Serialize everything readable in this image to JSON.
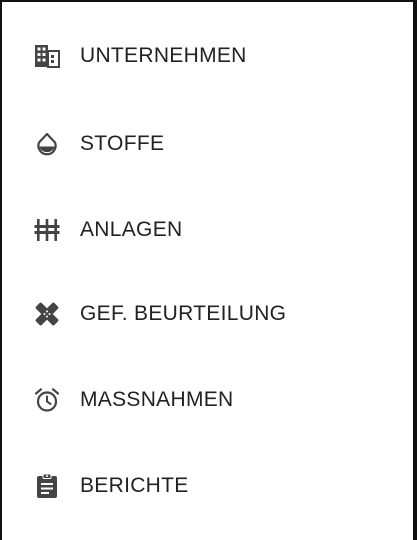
{
  "menu": {
    "items": [
      {
        "label": "UNTERNEHMEN",
        "icon": "domain-icon"
      },
      {
        "label": "STOFFE",
        "icon": "water-drop-icon"
      },
      {
        "label": "ANLAGEN",
        "icon": "equalizer-icon"
      },
      {
        "label": "GEF. BEURTEILUNG",
        "icon": "bandage-icon"
      },
      {
        "label": "MASSNAHMEN",
        "icon": "alarm-icon"
      },
      {
        "label": "BERICHTE",
        "icon": "clipboard-icon"
      }
    ]
  },
  "colors": {
    "icon": "#444444",
    "text": "#222222",
    "frame": "#111111"
  }
}
